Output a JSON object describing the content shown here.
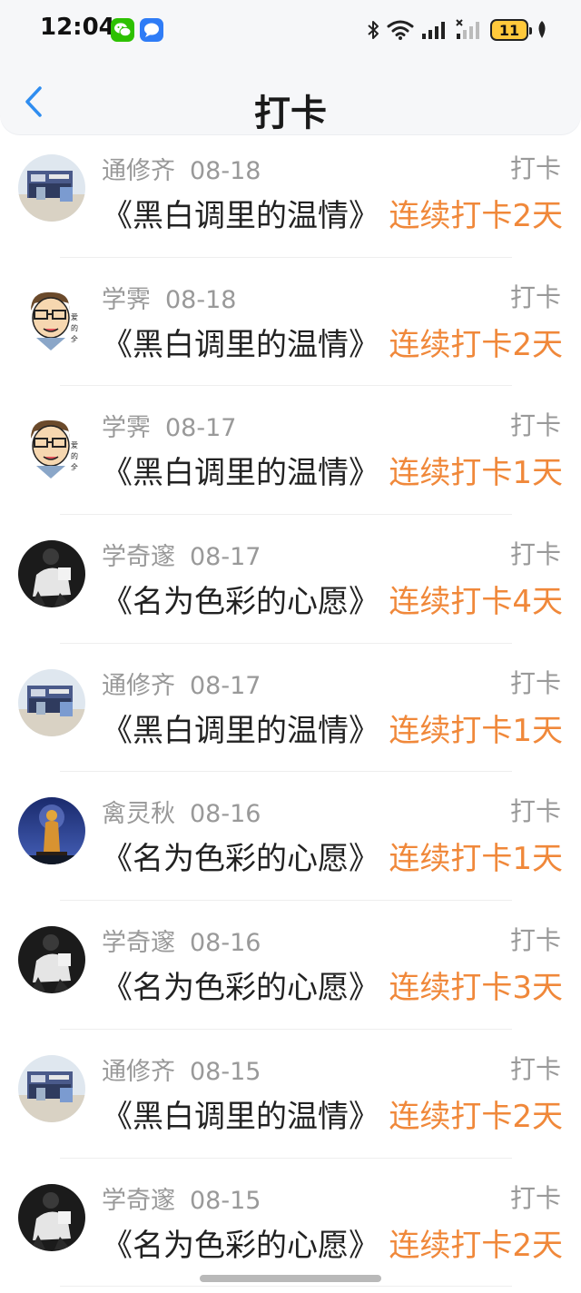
{
  "status_bar": {
    "time": "12:04",
    "battery_level": "11",
    "icons": [
      "wechat-icon",
      "message-icon",
      "bluetooth-icon",
      "wifi-icon",
      "signal-icon",
      "signal-no-sim-icon",
      "battery-icon",
      "leaf-icon"
    ]
  },
  "header": {
    "title": "打卡",
    "back_icon": "chevron-left-icon"
  },
  "colors": {
    "accent_orange": "#f0883a",
    "muted_gray": "#999999",
    "title_text": "#222222",
    "back_blue": "#2f8df0"
  },
  "items": [
    {
      "name": "通修齐",
      "date": "08-18",
      "action": "打卡",
      "title": "《黑白调里的温情》",
      "streak": "连续打卡2天",
      "avatar": "building-avatar"
    },
    {
      "name": "学霁",
      "date": "08-18",
      "action": "打卡",
      "title": "《黑白调里的温情》",
      "streak": "连续打卡2天",
      "avatar": "cartoon-avatar"
    },
    {
      "name": "学霁",
      "date": "08-17",
      "action": "打卡",
      "title": "《黑白调里的温情》",
      "streak": "连续打卡1天",
      "avatar": "cartoon-avatar"
    },
    {
      "name": "学奇邃",
      "date": "08-17",
      "action": "打卡",
      "title": "《名为色彩的心愿》",
      "streak": "连续打卡4天",
      "avatar": "person-bw-avatar"
    },
    {
      "name": "通修齐",
      "date": "08-17",
      "action": "打卡",
      "title": "《黑白调里的温情》",
      "streak": "连续打卡1天",
      "avatar": "building-avatar"
    },
    {
      "name": "禽灵秋",
      "date": "08-16",
      "action": "打卡",
      "title": "《名为色彩的心愿》",
      "streak": "连续打卡1天",
      "avatar": "statue-avatar"
    },
    {
      "name": "学奇邃",
      "date": "08-16",
      "action": "打卡",
      "title": "《名为色彩的心愿》",
      "streak": "连续打卡3天",
      "avatar": "person-bw-avatar"
    },
    {
      "name": "通修齐",
      "date": "08-15",
      "action": "打卡",
      "title": "《黑白调里的温情》",
      "streak": "连续打卡2天",
      "avatar": "building-avatar"
    },
    {
      "name": "学奇邃",
      "date": "08-15",
      "action": "打卡",
      "title": "《名为色彩的心愿》",
      "streak": "连续打卡2天",
      "avatar": "person-bw-avatar"
    }
  ]
}
